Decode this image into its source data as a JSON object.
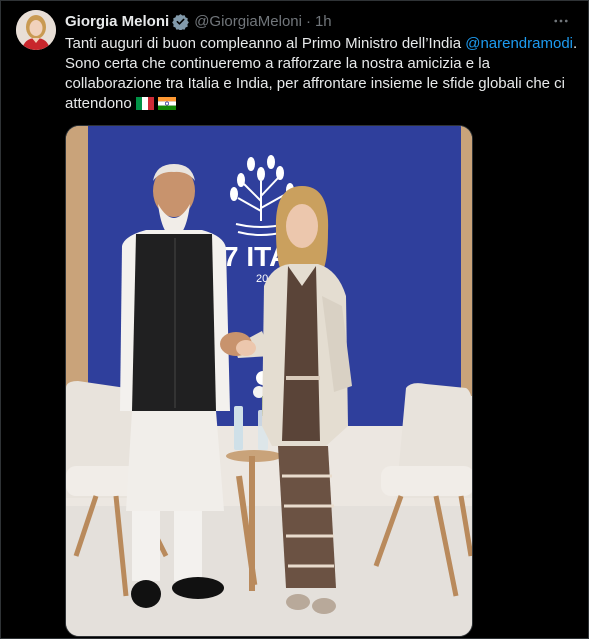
{
  "tweet": {
    "author_name": "Giorgia Meloni",
    "author_handle": "@GiorgiaMeloni",
    "separator": "·",
    "timestamp": "1h",
    "text_part1": "Tanti auguri di buon compleanno al Primo Ministro dell’India ",
    "mention": "@narendramodi",
    "text_part2": ". Sono certa che continueremo a rafforzare la nostra amicizia e la collaborazione tra Italia e India, per affrontare insieme le sfide globali che ci attendono",
    "flags": [
      "italy-flag",
      "india-flag"
    ]
  },
  "media": {
    "backdrop_text": "7 ITA",
    "backdrop_subtext": "20"
  },
  "colors": {
    "background": "#000000",
    "text": "#e7e9ea",
    "secondary_text": "#71767b",
    "link": "#1d9bf0",
    "verified": "#829aab",
    "backdrop_blue": "#2f3f9c"
  },
  "icons": {
    "verified": "verified-badge-icon",
    "more": "more-options-icon"
  }
}
